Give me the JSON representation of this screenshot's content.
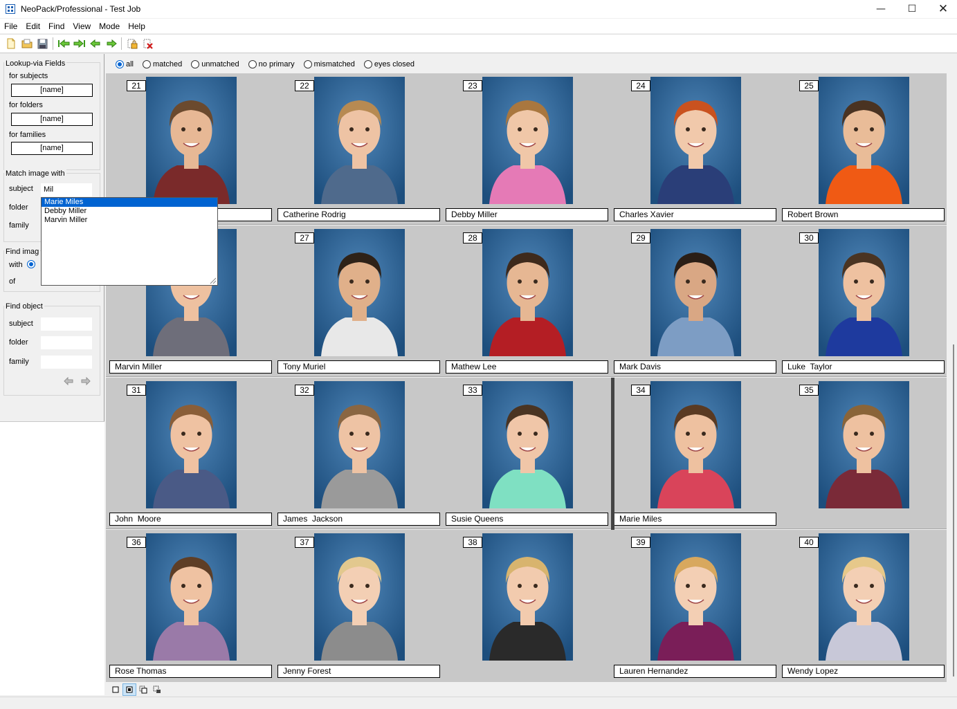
{
  "window": {
    "title": "NeoPack/Professional - Test Job"
  },
  "menu": [
    "File",
    "Edit",
    "Find",
    "View",
    "Mode",
    "Help"
  ],
  "toolbar_icons": [
    "new-file-icon",
    "open-folder-icon",
    "save-icon",
    "first-arrow-icon",
    "last-arrow-icon",
    "prev-arrow-icon",
    "next-arrow-icon",
    "lock-icon",
    "delete-icon"
  ],
  "left_panel": {
    "lookup": {
      "title": "Lookup-via Fields",
      "for_subjects": "for subjects",
      "subjects_value": "[name]",
      "for_folders": "for folders",
      "folders_value": "[name]",
      "for_families": "for families",
      "families_value": "[name]"
    },
    "match": {
      "title": "Match image with",
      "subject": "subject",
      "subject_value": "Mil",
      "folder": "folder",
      "family": "family"
    },
    "find_image": {
      "title": "Find imag",
      "with": "with",
      "of": "of"
    },
    "find_object": {
      "title": "Find object",
      "subject": "subject",
      "folder": "folder",
      "family": "family"
    }
  },
  "dropdown": {
    "items": [
      "Marie Miles",
      "Debby Miller",
      "Marvin Miller"
    ],
    "selected": "Marie Miles"
  },
  "filters": {
    "options": [
      "all",
      "matched",
      "unmatched",
      "no primary",
      "mismatched",
      "eyes closed"
    ],
    "selected": "all"
  },
  "photos": [
    {
      "num": "21",
      "name": ""
    },
    {
      "num": "22",
      "name": "Catherine Rodrig"
    },
    {
      "num": "23",
      "name": "Debby Miller"
    },
    {
      "num": "24",
      "name": "Charles Xavier"
    },
    {
      "num": "25",
      "name": "Robert Brown"
    },
    {
      "num": "",
      "name": "Marvin Miller"
    },
    {
      "num": "27",
      "name": "Tony Muriel"
    },
    {
      "num": "28",
      "name": "Mathew Lee"
    },
    {
      "num": "29",
      "name": "Mark Davis"
    },
    {
      "num": "30",
      "name": "Luke  Taylor"
    },
    {
      "num": "31",
      "name": "John  Moore"
    },
    {
      "num": "32",
      "name": "James  Jackson"
    },
    {
      "num": "33",
      "name": "Susie Queens"
    },
    {
      "num": "34",
      "name": "Marie Miles"
    },
    {
      "num": "35",
      "name": ""
    },
    {
      "num": "36",
      "name": "Rose Thomas"
    },
    {
      "num": "37",
      "name": "Jenny Forest"
    },
    {
      "num": "38",
      "name": ""
    },
    {
      "num": "39",
      "name": "Lauren Hernandez"
    },
    {
      "num": "40",
      "name": "Wendy Lopez"
    }
  ],
  "photo_style": [
    {
      "shirt": "#7a2a2a",
      "hair": "#6b4a2e",
      "skin": "#e7b895"
    },
    {
      "shirt": "#4f6a8c",
      "hair": "#b78a52",
      "skin": "#eec3a4"
    },
    {
      "shirt": "#e57ab6",
      "hair": "#a9773f",
      "skin": "#f0c7a8"
    },
    {
      "shirt": "#2a3e78",
      "hair": "#c9521f",
      "skin": "#f1c9ab"
    },
    {
      "shirt": "#f05a14",
      "hair": "#4a3322",
      "skin": "#e9bc98"
    },
    {
      "shirt": "#6e6e7a",
      "hair": "#7a5a3a",
      "skin": "#eec1a0"
    },
    {
      "shirt": "#e8e8e8",
      "hair": "#2e2218",
      "skin": "#e0b08a"
    },
    {
      "shirt": "#b41e24",
      "hair": "#3e2a1c",
      "skin": "#e6b793"
    },
    {
      "shirt": "#7d9dc4",
      "hair": "#2a1e16",
      "skin": "#d9a784"
    },
    {
      "shirt": "#1e3a9e",
      "hair": "#4a3422",
      "skin": "#eec1a0"
    },
    {
      "shirt": "#4a5a86",
      "hair": "#8a5e38",
      "skin": "#efc2a2"
    },
    {
      "shirt": "#9a9a9a",
      "hair": "#8a6642",
      "skin": "#eec3a4"
    },
    {
      "shirt": "#7fe0c2",
      "hair": "#4a3422",
      "skin": "#f0c6a8"
    },
    {
      "shirt": "#d9445a",
      "hair": "#5a3a22",
      "skin": "#eec1a0"
    },
    {
      "shirt": "#7a2a38",
      "hair": "#8a6438",
      "skin": "#eec1a0"
    },
    {
      "shirt": "#9a7aa8",
      "hair": "#5e3e26",
      "skin": "#efc2a2"
    },
    {
      "shirt": "#8c8c8c",
      "hair": "#e2c88e",
      "skin": "#f3cfb4"
    },
    {
      "shirt": "#2a2a2a",
      "hair": "#d8b46e",
      "skin": "#f2cbae"
    },
    {
      "shirt": "#7a1e58",
      "hair": "#d8a85e",
      "skin": "#f3cfb4"
    },
    {
      "shirt": "#c8c8d8",
      "hair": "#e6c88a",
      "skin": "#f3cfb4"
    }
  ],
  "bottom_icons": [
    "single-view-icon",
    "grid-view-icon",
    "multi-select-icon",
    "lock-select-icon"
  ],
  "colors": {
    "accent": "#0063d1",
    "photo_bg": "#1d4e7d"
  }
}
